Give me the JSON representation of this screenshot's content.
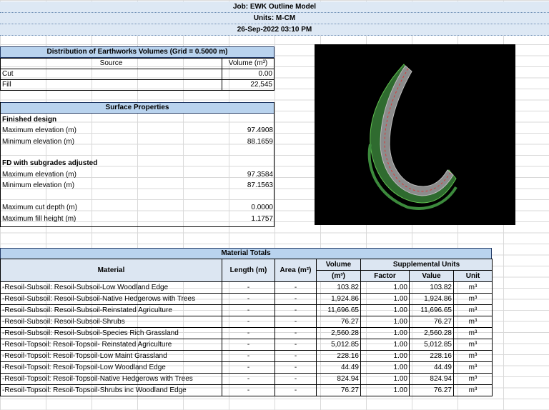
{
  "header": {
    "job": "Job: EWK Outline Model",
    "units": "Units: M-CM",
    "datetime": "26-Sep-2022 03:10 PM"
  },
  "earthworks": {
    "title": "Distribution of Earthworks Volumes (Grid = 0.5000 m)",
    "col_source": "Source",
    "col_volume": "Volume (m³)",
    "rows": [
      {
        "source": "Cut",
        "volume": "0.00"
      },
      {
        "source": "Fill",
        "volume": "22,545"
      }
    ]
  },
  "surface": {
    "title": "Surface Properties",
    "finished_label": "Finished design",
    "fd_max_label": "Maximum elevation (m)",
    "fd_max": "97.4908",
    "fd_min_label": "Minimum elevation (m)",
    "fd_min": "88.1659",
    "sub_label": "FD with subgrades adjusted",
    "sub_max_label": "Maximum elevation (m)",
    "sub_max": "97.3584",
    "sub_min_label": "Minimum elevation (m)",
    "sub_min": "87.1563",
    "cut_depth_label": "Maximum cut depth (m)",
    "cut_depth": "0.0000",
    "fill_height_label": "Maximum fill height (m)",
    "fill_height": "1.1757"
  },
  "materials": {
    "title": "Material Totals",
    "col_material": "Material",
    "col_length": "Length (m)",
    "col_area": "Area (m²)",
    "col_volume": "Volume",
    "col_volume_unit": "(m³)",
    "col_supp": "Supplemental Units",
    "col_factor": "Factor",
    "col_value": "Value",
    "col_unit": "Unit",
    "rows": [
      {
        "name": "-Resoil-Subsoil: Resoil-Subsoil-Low Woodland Edge",
        "length": "-",
        "area": "-",
        "volume": "103.82",
        "factor": "1.00",
        "value": "103.82",
        "unit": "m³"
      },
      {
        "name": "-Resoil-Subsoil: Resoil-Subsoil-Native Hedgerows with Trees",
        "length": "-",
        "area": "-",
        "volume": "1,924.86",
        "factor": "1.00",
        "value": "1,924.86",
        "unit": "m³"
      },
      {
        "name": "-Resoil-Subsoil: Resoil-Subsoil-Reinstated Agriculture",
        "length": "-",
        "area": "-",
        "volume": "11,696.65",
        "factor": "1.00",
        "value": "11,696.65",
        "unit": "m³"
      },
      {
        "name": "-Resoil-Subsoil: Resoil-Subsoil-Shrubs",
        "length": "-",
        "area": "-",
        "volume": "76.27",
        "factor": "1.00",
        "value": "76.27",
        "unit": "m³"
      },
      {
        "name": "-Resoil-Subsoil: Resoil-Subsoil-Species Rich Grassland",
        "length": "-",
        "area": "-",
        "volume": "2,560.28",
        "factor": "1.00",
        "value": "2,560.28",
        "unit": "m³"
      },
      {
        "name": "-Resoil-Topsoil: Resoil-Topsoil- Reinstated Agriculture",
        "length": "-",
        "area": "-",
        "volume": "5,012.85",
        "factor": "1.00",
        "value": "5,012.85",
        "unit": "m³"
      },
      {
        "name": "-Resoil-Topsoil: Resoil-Topsoil-Low Maint Grassland",
        "length": "-",
        "area": "-",
        "volume": "228.16",
        "factor": "1.00",
        "value": "228.16",
        "unit": "m³"
      },
      {
        "name": "-Resoil-Topsoil: Resoil-Topsoil-Low Woodland Edge",
        "length": "-",
        "area": "-",
        "volume": "44.49",
        "factor": "1.00",
        "value": "44.49",
        "unit": "m³"
      },
      {
        "name": "-Resoil-Topsoil: Resoil-Topsoil-Native Hedgerows with Trees",
        "length": "-",
        "area": "-",
        "volume": "824.94",
        "factor": "1.00",
        "value": "824.94",
        "unit": "m³"
      },
      {
        "name": "-Resoil-Topsoil: Resoil-Topsoil-Shrubs inc Woodland Edge",
        "length": "-",
        "area": "-",
        "volume": "76.27",
        "factor": "1.00",
        "value": "76.27",
        "unit": "m³"
      }
    ]
  }
}
